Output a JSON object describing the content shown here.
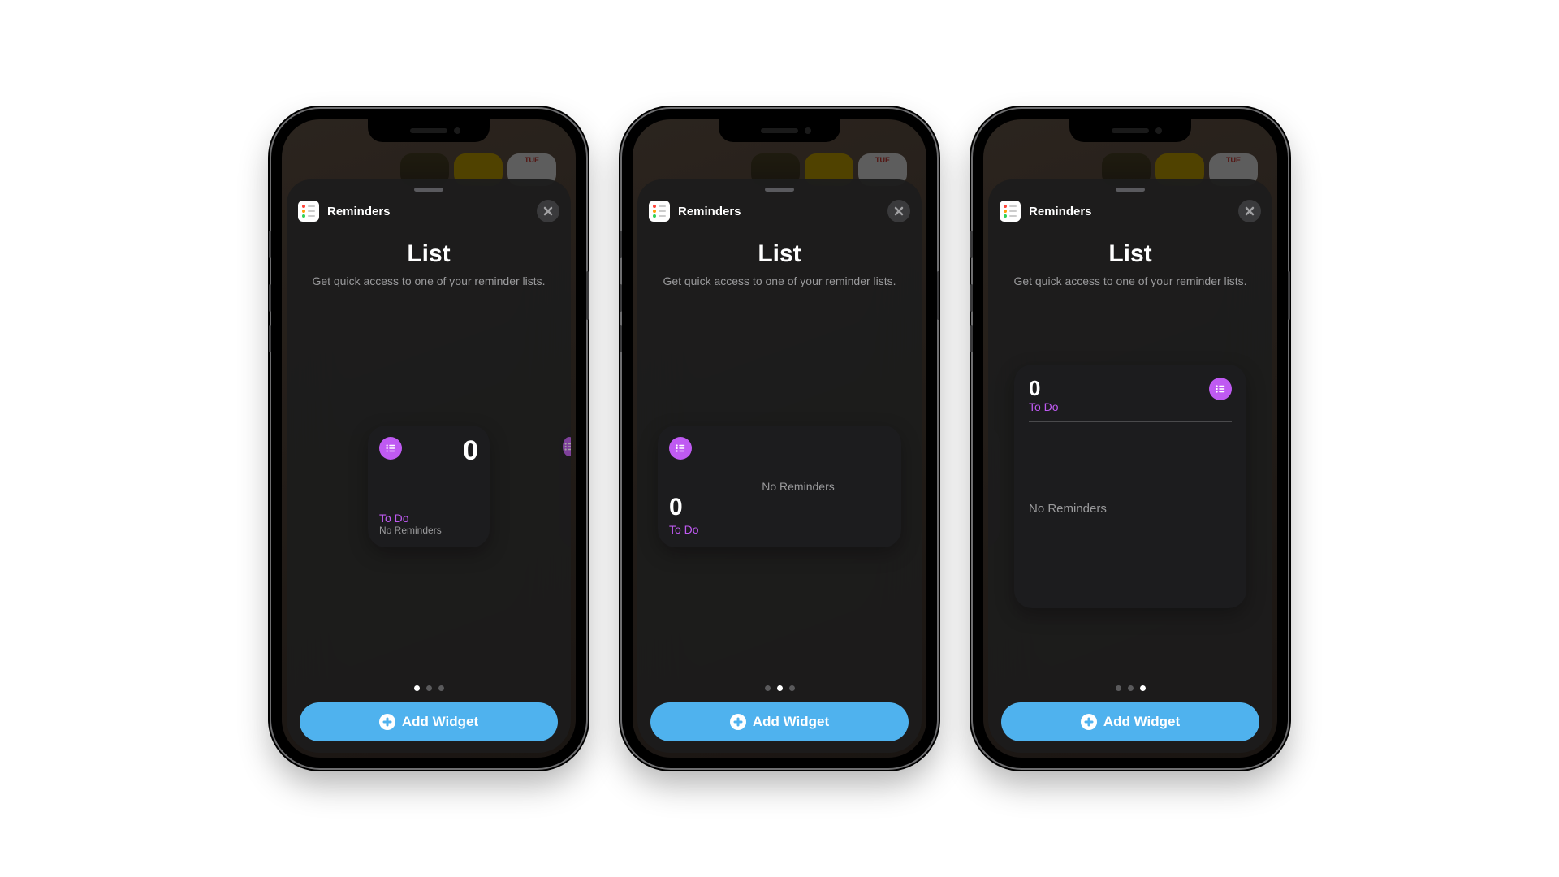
{
  "bg_day_label": "TUE",
  "colors": {
    "accent_purple": "#bf5af2",
    "button_blue": "#4fb2ee"
  },
  "reminders_icon_colors": [
    "#ff453a",
    "#ff9f0a",
    "#30d158"
  ],
  "phones": [
    {
      "app_name": "Reminders",
      "title": "List",
      "subtitle": "Get quick access to one of your reminder lists.",
      "widget": {
        "size": "small",
        "count": "0",
        "list_name": "To Do",
        "empty_text": "No Reminders"
      },
      "active_page_index": 0,
      "add_button_label": "Add Widget"
    },
    {
      "app_name": "Reminders",
      "title": "List",
      "subtitle": "Get quick access to one of your reminder lists.",
      "widget": {
        "size": "medium",
        "count": "0",
        "list_name": "To Do",
        "empty_text": "No Reminders"
      },
      "active_page_index": 1,
      "add_button_label": "Add Widget"
    },
    {
      "app_name": "Reminders",
      "title": "List",
      "subtitle": "Get quick access to one of your reminder lists.",
      "widget": {
        "size": "large",
        "count": "0",
        "list_name": "To Do",
        "empty_text": "No Reminders"
      },
      "active_page_index": 2,
      "add_button_label": "Add Widget"
    }
  ]
}
